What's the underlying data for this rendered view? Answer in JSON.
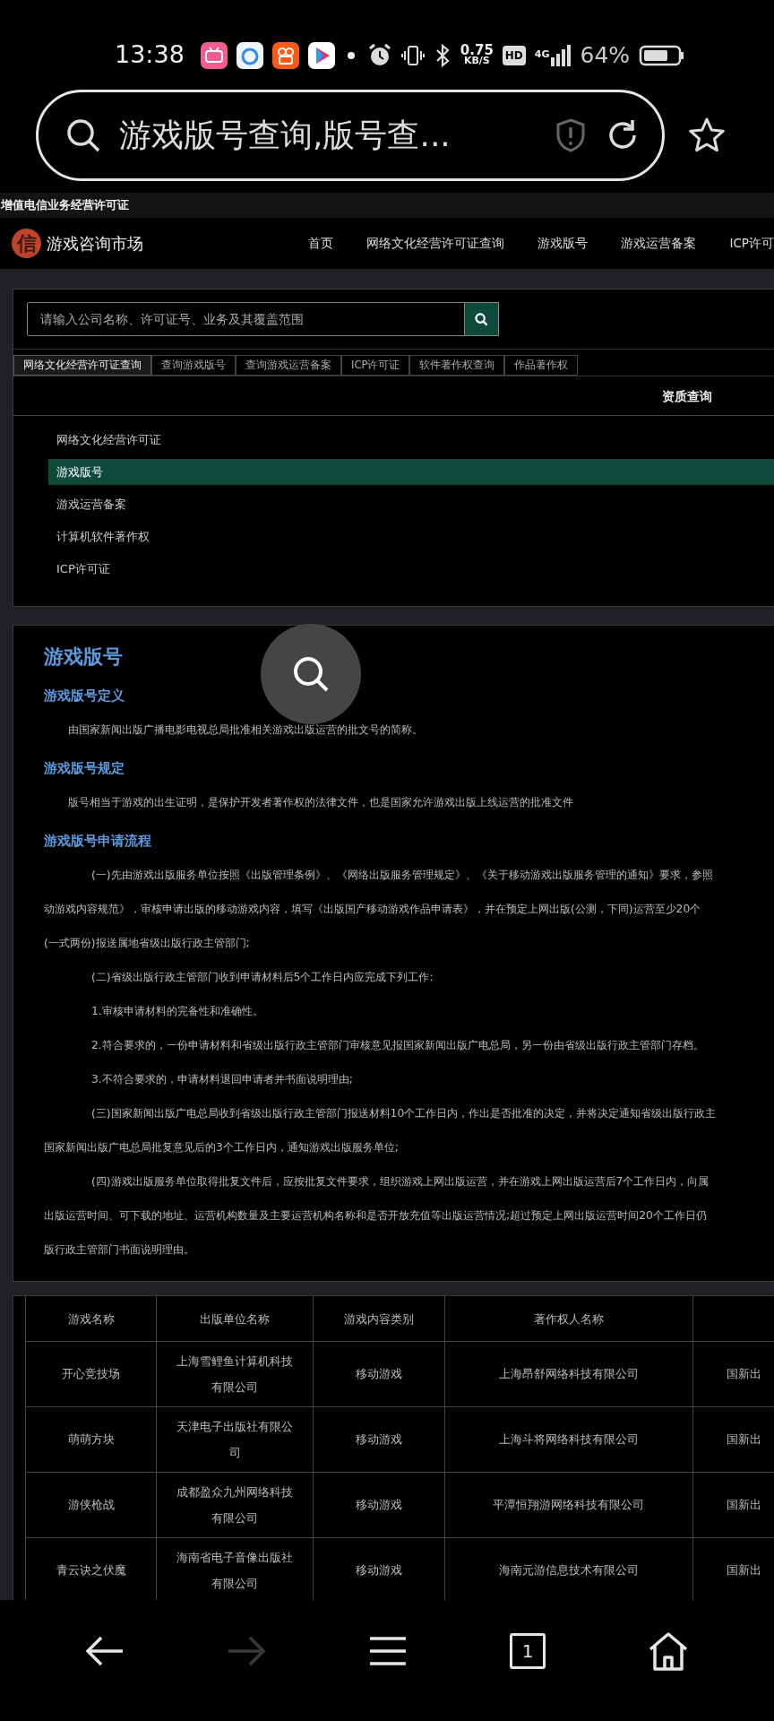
{
  "status_bar": {
    "time": "13:38",
    "net_speed": "0.75",
    "net_unit": "KB/S",
    "hd": "HD",
    "network": "4G",
    "battery": "64%"
  },
  "address_bar": {
    "text": "游戏版号查询,版号查..."
  },
  "site": {
    "top_strip": "增值电信业务经营许可证",
    "logo": "信",
    "brand": "游戏咨询市场",
    "nav": [
      {
        "label": "首页"
      },
      {
        "label": "网络文化经营许可证查询"
      },
      {
        "label": "游戏版号"
      },
      {
        "label": "游戏运营备案"
      },
      {
        "label": "ICP许可"
      }
    ]
  },
  "search": {
    "placeholder": "请输入公司名称、许可证号、业务及其覆盖范围"
  },
  "tabs": [
    {
      "label": "网络文化经营许可证查询",
      "selected": true
    },
    {
      "label": "查询游戏版号",
      "selected": false
    },
    {
      "label": "查询游戏运营备案",
      "selected": false
    },
    {
      "label": "ICP许可证",
      "selected": false
    },
    {
      "label": "软件著作权查询",
      "selected": false
    },
    {
      "label": "作品著作权",
      "selected": false
    }
  ],
  "panel_title": "资质查询",
  "categories": [
    {
      "label": "网络文化经营许可证",
      "selected": false
    },
    {
      "label": "游戏版号",
      "selected": true
    },
    {
      "label": "游戏运营备案",
      "selected": false
    },
    {
      "label": "计算机软件著作权",
      "selected": false
    },
    {
      "label": "ICP许可证",
      "selected": false
    }
  ],
  "article": {
    "title": "游戏版号",
    "sections": [
      {
        "heading": "游戏版号定义",
        "kind": "note",
        "paragraphs": [
          {
            "lines": [
              "由国家新闻出版广播电影电视总局批准相关游戏出版运营的批文号的简称。"
            ]
          }
        ]
      },
      {
        "heading": "游戏版号规定",
        "kind": "note",
        "paragraphs": [
          {
            "lines": [
              "版号相当于游戏的出生证明，是保护开发者著作权的法律文件，也是国家允许游戏出版上线运营的批准文件"
            ]
          }
        ]
      },
      {
        "heading": "游戏版号申请流程",
        "kind": "steps",
        "paragraphs": [
          {
            "lines": [
              "(一)先由游戏出版服务单位按照《出版管理条例》、《网络出版服务管理规定》、《关于移动游戏出版服务管理的通知》要求，参照",
              "动游戏内容规范》，审核申请出版的移动游戏内容，填写《出版国产移动游戏作品申请表》，并在预定上网出版(公测，下同)运营至少20个",
              "(一式两份)报送属地省级出版行政主管部门;"
            ]
          },
          {
            "lines": [
              "(二)省级出版行政主管部门收到申请材料后5个工作日内应完成下列工作:"
            ]
          },
          {
            "lines": [
              "1.审核申请材料的完备性和准确性。"
            ]
          },
          {
            "lines": [
              "2.符合要求的，一份申请材料和省级出版行政主管部门审核意见报国家新闻出版广电总局，另一份由省级出版行政主管部门存档。"
            ]
          },
          {
            "lines": [
              "3.不符合要求的，申请材料退回申请者并书面说明理由;"
            ]
          },
          {
            "lines": [
              "(三)国家新闻出版广电总局收到省级出版行政主管部门报送材料10个工作日内，作出是否批准的决定，并将决定通知省级出版行政主",
              "国家新闻出版广电总局批复意见后的3个工作日内，通知游戏出版服务单位;"
            ]
          },
          {
            "lines": [
              "(四)游戏出版服务单位取得批复文件后，应按批复文件要求，组织游戏上网出版运营，并在游戏上网出版运营后7个工作日内，向属",
              "出版运营时间、可下载的地址、运营机构数量及主要运营机构名称和是否开放充值等出版运营情况;超过预定上网出版运营时间20个工作日仍",
              "版行政主管部门书面说明理由。"
            ]
          }
        ]
      }
    ]
  },
  "table": {
    "columns": [
      "游戏名称",
      "出版单位名称",
      "游戏内容类别",
      "著作权人名称"
    ],
    "rows": [
      {
        "game": "开心竞技场",
        "publisher": "上海雪鲤鱼计算机科技有限公司",
        "category": "移动游戏",
        "owner": "上海昂舒网络科技有限公司",
        "column_5": "国新出"
      },
      {
        "game": "萌萌方块",
        "publisher": "天津电子出版社有限公司",
        "category": "移动游戏",
        "owner": "上海斗将网络科技有限公司",
        "column_5": "国新出"
      },
      {
        "game": "游侠枪战",
        "publisher": "成都盈众九州网络科技有限公司",
        "category": "移动游戏",
        "owner": "平潭恒翔游网络科技有限公司",
        "column_5": "国新出"
      },
      {
        "game": "青云诀之伏魔",
        "publisher": "海南省电子音像出版社有限公司",
        "category": "移动游戏",
        "owner": "海南元游信息技术有限公司",
        "column_5": "国新出"
      }
    ]
  },
  "bottom_nav": [
    {
      "kind": "back",
      "disabled": false
    },
    {
      "kind": "forward",
      "disabled": true
    },
    {
      "kind": "menu",
      "disabled": false
    },
    {
      "kind": "tabs",
      "count": "1",
      "disabled": false
    },
    {
      "kind": "home",
      "disabled": false
    }
  ]
}
